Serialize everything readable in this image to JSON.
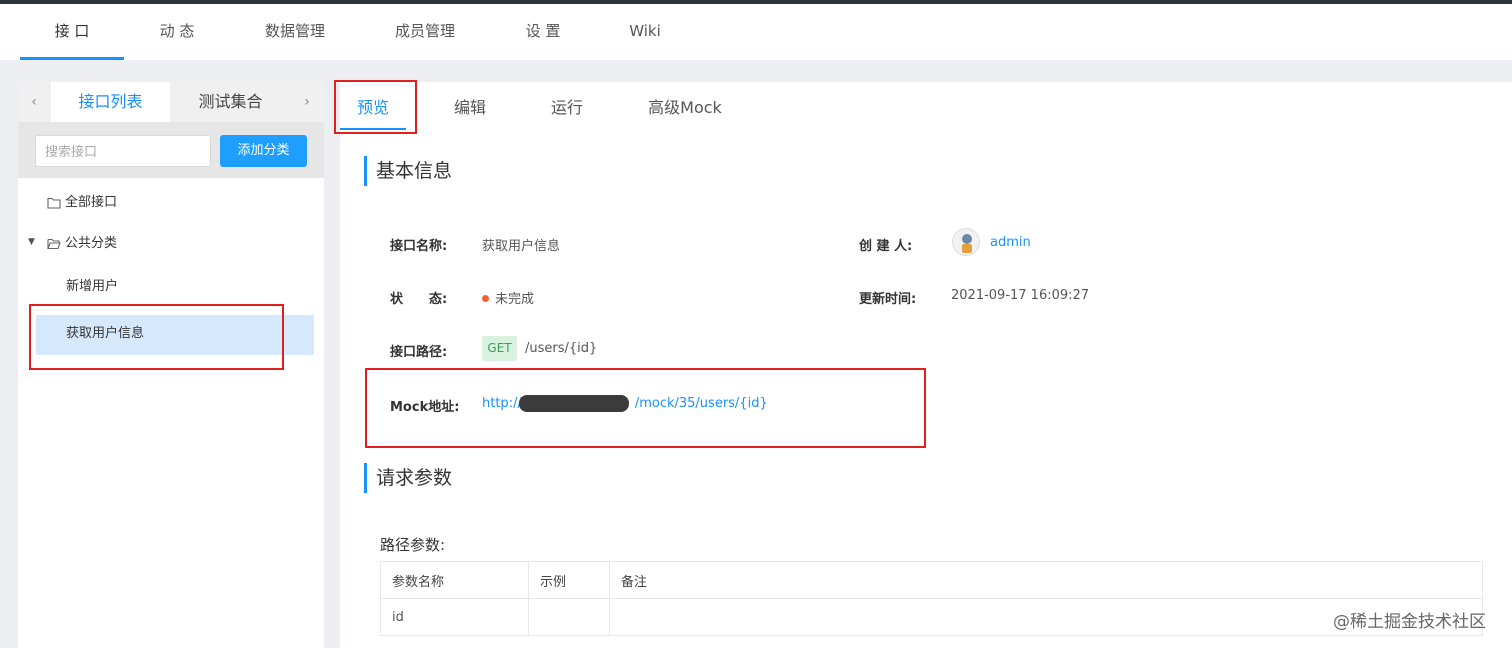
{
  "topnav": {
    "tabs": [
      {
        "label": "接 口",
        "active": true
      },
      {
        "label": "动 态"
      },
      {
        "label": "数据管理"
      },
      {
        "label": "成员管理"
      },
      {
        "label": "设 置"
      },
      {
        "label": "Wiki"
      }
    ]
  },
  "sidebar": {
    "prev_arrow": "‹",
    "next_arrow": "›",
    "tabs": [
      {
        "label": "接口列表",
        "active": true
      },
      {
        "label": "测试集合"
      }
    ],
    "search_placeholder": "搜索接口",
    "add_category_label": "添加分类",
    "tree": {
      "all": "全部接口",
      "category": "公共分类",
      "interfaces": [
        "新增用户",
        "获取用户信息"
      ],
      "selected": "获取用户信息"
    }
  },
  "main": {
    "tabs": [
      {
        "label": "预览",
        "active": true
      },
      {
        "label": "编辑"
      },
      {
        "label": "运行"
      },
      {
        "label": "高级Mock"
      }
    ],
    "basic_info": {
      "title": "基本信息",
      "name_label": "接口名称:",
      "name_value": "获取用户信息",
      "creator_label": "创 建 人:",
      "creator_value": "admin",
      "status_label": "状　　态:",
      "status_value": "未完成",
      "status_color": "#f5632a",
      "updated_label": "更新时间:",
      "updated_value": "2021-09-17 16:09:27",
      "path_label": "接口路径:",
      "method": "GET",
      "path_value": "/users/{id}",
      "mock_label": "Mock地址:",
      "mock_prefix": "http://",
      "mock_suffix": "/mock/35/users/{id}"
    },
    "request_params": {
      "title": "请求参数",
      "path_params_title": "路径参数:",
      "columns": [
        "参数名称",
        "示例",
        "备注"
      ],
      "rows": [
        [
          "id",
          "",
          ""
        ]
      ]
    }
  },
  "watermark": "@稀土掘金技术社区",
  "colors": {
    "accent": "#1890ff",
    "highlight_box": "#e02020",
    "selected_bg": "#d6e8fb"
  }
}
